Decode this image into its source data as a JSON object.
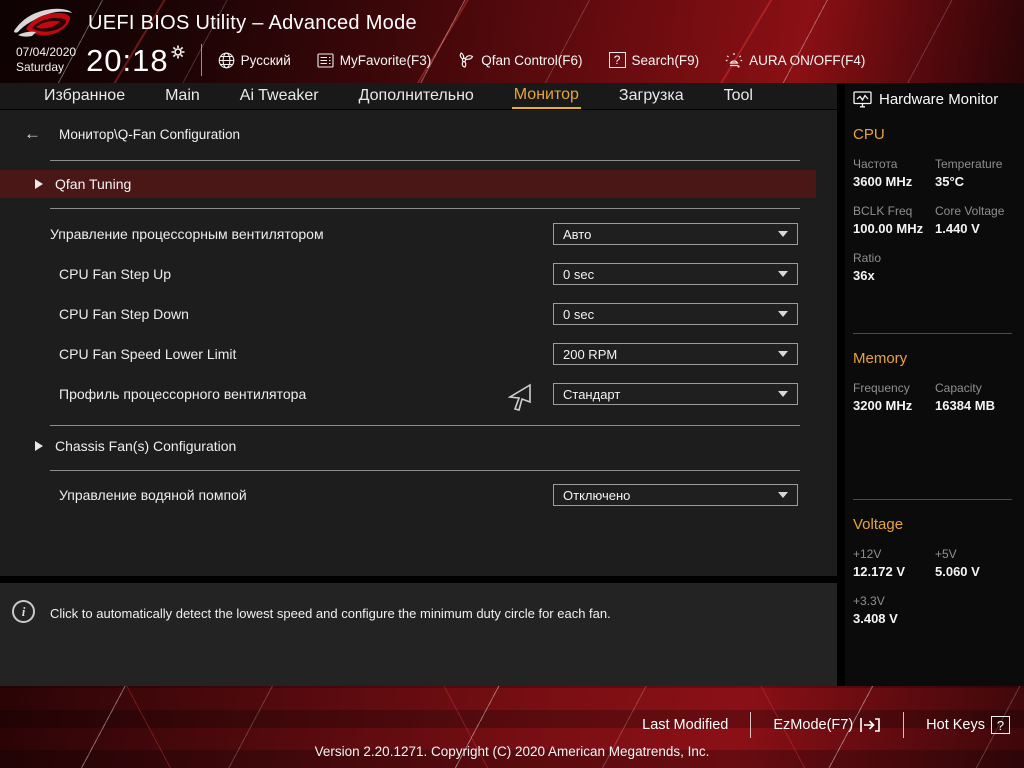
{
  "header": {
    "title": "UEFI BIOS Utility – Advanced Mode",
    "date": "07/04/2020",
    "day": "Saturday",
    "time": "20:18",
    "buttons": {
      "language": "Русский",
      "myfavorite": "MyFavorite(F3)",
      "qfan": "Qfan Control(F6)",
      "search": "Search(F9)",
      "aura": "AURA ON/OFF(F4)"
    }
  },
  "nav": {
    "tabs": [
      {
        "label": "Избранное"
      },
      {
        "label": "Main"
      },
      {
        "label": "Ai Tweaker"
      },
      {
        "label": "Дополнительно"
      },
      {
        "label": "Монитор"
      },
      {
        "label": "Загрузка"
      },
      {
        "label": "Tool"
      }
    ],
    "active_tab": "Монитор"
  },
  "breadcrumb": "Монитор\\Q-Fan Configuration",
  "content": {
    "qfan_tuning": "Qfan Tuning",
    "chassis_config": "Chassis Fan(s) Configuration",
    "settings": [
      {
        "label": "Управление процессорным вентилятором",
        "value": "Авто"
      },
      {
        "label": "CPU Fan Step Up",
        "value": "0 sec"
      },
      {
        "label": "CPU Fan Step Down",
        "value": "0 sec"
      },
      {
        "label": "CPU Fan Speed Lower Limit",
        "value": "200 RPM"
      },
      {
        "label": "Профиль процессорного вентилятора",
        "value": "Стандарт"
      }
    ],
    "pump": {
      "label": "Управление водяной помпой",
      "value": "Отключено"
    }
  },
  "help": "Click to automatically detect the lowest speed and configure the minimum duty circle for each fan.",
  "hardware_monitor": {
    "title": "Hardware Monitor",
    "cpu": {
      "name": "CPU",
      "freq_label": "Частота",
      "freq_value": "3600 MHz",
      "temp_label": "Temperature",
      "temp_value": "35°C",
      "bclk_label": "BCLK Freq",
      "bclk_value": "100.00 MHz",
      "core_label": "Core Voltage",
      "core_value": "1.440 V",
      "ratio_label": "Ratio",
      "ratio_value": "36x"
    },
    "memory": {
      "name": "Memory",
      "freq_label": "Frequency",
      "freq_value": "3200 MHz",
      "cap_label": "Capacity",
      "cap_value": "16384 MB"
    },
    "voltage": {
      "name": "Voltage",
      "v12_label": "+12V",
      "v12_value": "12.172 V",
      "v5_label": "+5V",
      "v5_value": "5.060 V",
      "v33_label": "+3.3V",
      "v33_value": "3.408 V"
    }
  },
  "footer": {
    "last_modified": "Last Modified",
    "ezmode": "EzMode(F7)",
    "hotkeys": "Hot Keys",
    "hotkeys_badge": "?",
    "version": "Version 2.20.1271. Copyright (C) 2020 American Megatrends, Inc."
  },
  "colors": {
    "accent_yellow": "#e8a33d",
    "tab_underline": "#edb11c",
    "selected_row_maroon": "#4a1616",
    "header_red": "#8a1014"
  }
}
